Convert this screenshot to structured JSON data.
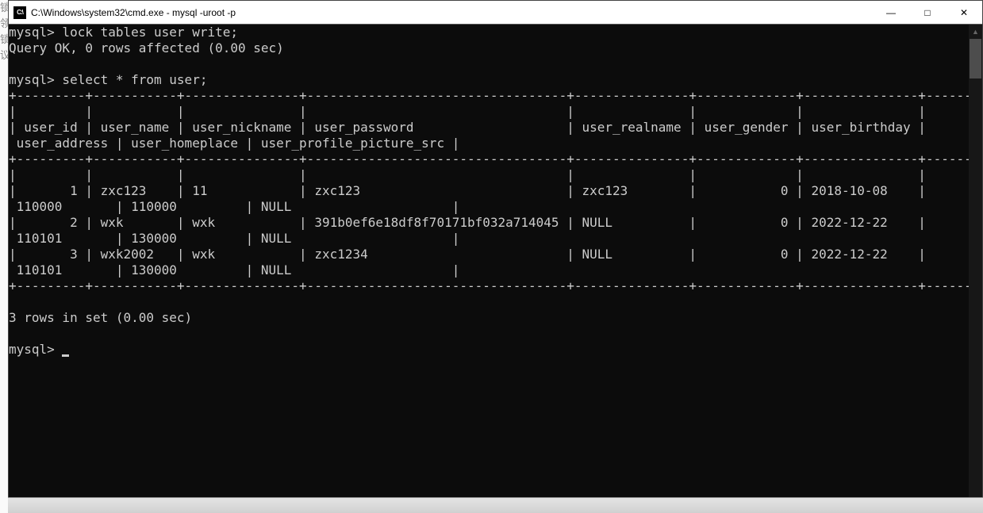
{
  "left_chars": [
    "锁",
    "",
    "",
    "",
    "领",
    "",
    "",
    "",
    "锁",
    "",
    "议",
    "",
    "",
    "",
    "",
    "",
    "",
    "",
    "",
    ""
  ],
  "titlebar": {
    "icon_text": "C:\\",
    "title": "C:\\Windows\\system32\\cmd.exe - mysql  -uroot -p"
  },
  "buttons": {
    "minimize": "—",
    "maximize": "□",
    "close": "✕"
  },
  "terminal": {
    "prompt": "mysql>",
    "cmd1": "lock tables user write;",
    "resp1": "Query OK, 0 rows affected (0.00 sec)",
    "cmd2": "select * from user;",
    "separator": "+---------+-----------+---------------+----------------------------------+---------------+-------------+---------------+--------------+----------------+--------------------------+",
    "blank_pipes": "|         |           |               |                                  |               |             |               |              |                |                          |",
    "header_row1": "| user_id | user_name | user_nickname | user_password                    | user_realname | user_gender | user_birthday |",
    "header_row2": " user_address | user_homeplace | user_profile_picture_src |",
    "data_row1a": "|       1 | zxc123    | 11            | zxc123                           | zxc123        |           0 | 2018-10-08    |",
    "data_row1b": " 110000       | 110000         | NULL                     |",
    "data_row2a": "|       2 | wxk       | wxk           | 391b0ef6e18df8f70171bf032a714045 | NULL          |           0 | 2022-12-22    |",
    "data_row2b": " 110101       | 130000         | NULL                     |",
    "data_row3a": "|       3 | wxk2002   | wxk           | zxc1234                          | NULL          |           0 | 2022-12-22    |",
    "data_row3b": " 110101       | 130000         | NULL                     |",
    "footer": "3 rows in set (0.00 sec)"
  },
  "scrollbar": {
    "up": "▲",
    "down": "▼"
  }
}
